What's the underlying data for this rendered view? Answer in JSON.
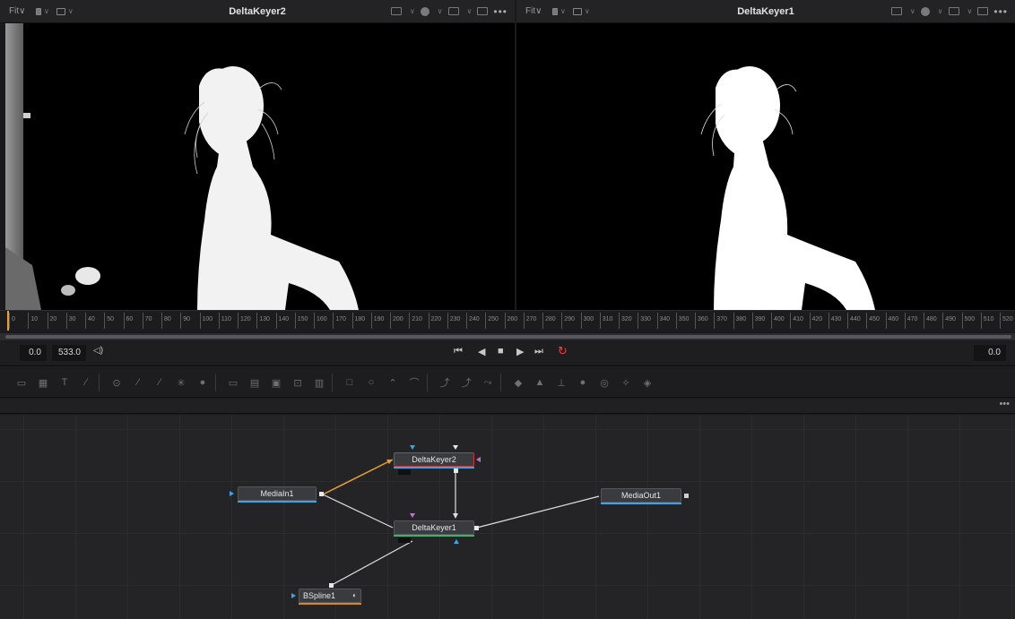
{
  "viewer_left": {
    "fit_label": "Fit∨",
    "title": "DeltaKeyer2",
    "more": "•••"
  },
  "viewer_right": {
    "fit_label": "Fit∨",
    "title": "DeltaKeyer1",
    "more": "•••"
  },
  "ruler": {
    "ticks": [
      "0",
      "10",
      "20",
      "30",
      "40",
      "50",
      "60",
      "70",
      "80",
      "90",
      "100",
      "110",
      "120",
      "130",
      "140",
      "150",
      "160",
      "170",
      "180",
      "190",
      "200",
      "210",
      "220",
      "230",
      "240",
      "250",
      "260",
      "270",
      "280",
      "290",
      "300",
      "310",
      "320",
      "330",
      "340",
      "350",
      "360",
      "370",
      "380",
      "390",
      "400",
      "410",
      "420",
      "430",
      "440",
      "450",
      "460",
      "470",
      "480",
      "490",
      "500",
      "510",
      "520"
    ]
  },
  "transport": {
    "current_time": "0.0",
    "render_end": "533.0",
    "speaker_glyph": "◁)",
    "right_time": "0.0",
    "buttons": {
      "to_start": "⏮",
      "reverse": "◀",
      "stop": "■",
      "play": "▶",
      "to_end": "⏭",
      "loop": "↻"
    }
  },
  "toolbar": {
    "tools": [
      "background-icon",
      "gradient-icon",
      "text-icon",
      "paint-icon",
      "particles-icon",
      "polygon-icon",
      "bspline-icon",
      "brightness-icon",
      "blur-icon",
      "merge-icon",
      "matte-control-icon",
      "color-corrector-icon",
      "resize-icon",
      "transform-icon",
      "rectangle-mask-icon",
      "ellipse-mask-icon",
      "polygon-mask-icon",
      "bspline-mask-icon",
      "tracker-icon",
      "planar-tracker-icon",
      "camera-tracker-icon",
      "shape3d-icon",
      "text3d-icon",
      "merge3d-icon",
      "renderer3d-icon",
      "camera3d-icon",
      "light3d-icon",
      "fbx-icon"
    ]
  },
  "nodebar": {
    "more": "•••"
  },
  "nodes": {
    "mediain": {
      "label": "MediaIn1"
    },
    "keyer2": {
      "label": "DeltaKeyer2"
    },
    "keyer1": {
      "label": "DeltaKeyer1"
    },
    "mediaout": {
      "label": "MediaOut1"
    },
    "bspline": {
      "label": "BSpline1"
    }
  },
  "colors": {
    "accent_orange": "#e8a030",
    "selected_red": "#c23a3a",
    "port_blue": "#39a5e8",
    "port_magenta": "#c86bd8",
    "mask_orange": "#d38a1a"
  }
}
